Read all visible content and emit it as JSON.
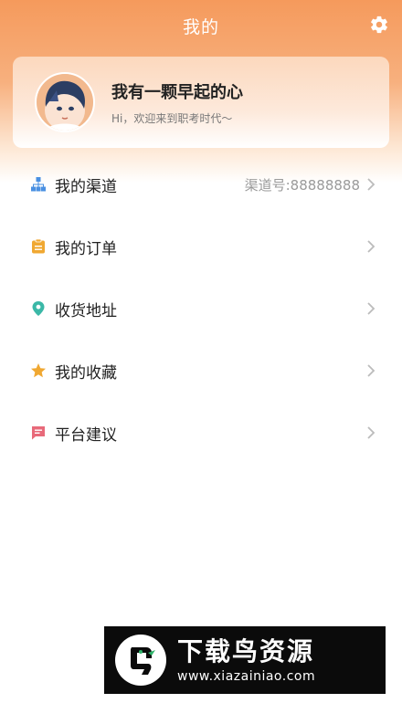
{
  "navbar": {
    "title": "我的"
  },
  "profile": {
    "name": "我有一颗早起的心",
    "welcome": "Hi，欢迎来到职考时代～"
  },
  "menu": [
    {
      "label": "我的渠道",
      "value": "渠道号:88888888",
      "icon": "channel-icon",
      "color": "#4a90e2"
    },
    {
      "label": "我的订单",
      "value": "",
      "icon": "order-icon",
      "color": "#f0a832"
    },
    {
      "label": "收货地址",
      "value": "",
      "icon": "location-icon",
      "color": "#3bb8a7"
    },
    {
      "label": "我的收藏",
      "value": "",
      "icon": "star-icon",
      "color": "#f0a832"
    },
    {
      "label": "平台建议",
      "value": "",
      "icon": "message-icon",
      "color": "#e86a7a"
    }
  ],
  "watermark": {
    "title": "下载鸟资源",
    "url": "www.xiazainiao.com"
  },
  "colors": {
    "accent": "#f59a5c",
    "chevron": "#bbbbbb"
  }
}
